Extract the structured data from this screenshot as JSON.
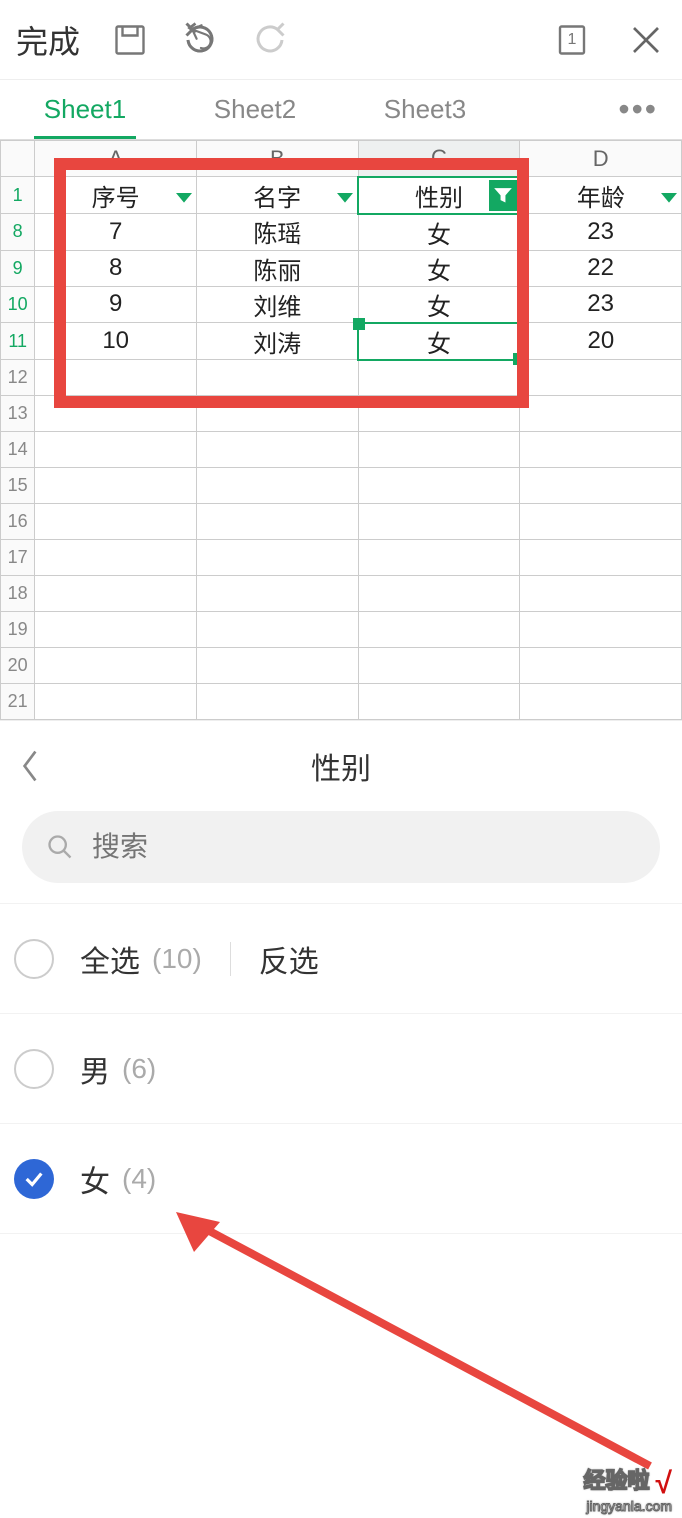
{
  "toolbar": {
    "done_label": "完成",
    "notif_count": "1"
  },
  "sheets": {
    "tab1": "Sheet1",
    "tab2": "Sheet2",
    "tab3": "Sheet3",
    "more": "•••"
  },
  "columns": {
    "A": "A",
    "B": "B",
    "C": "C",
    "D": "D"
  },
  "headers": {
    "A": "序号",
    "B": "名字",
    "C": "性别",
    "D": "年龄"
  },
  "rownums": {
    "h": "1",
    "r1": "8",
    "r2": "9",
    "r3": "10",
    "r4": "11",
    "e12": "12",
    "e13": "13",
    "e14": "14",
    "e15": "15",
    "e16": "16",
    "e17": "17",
    "e18": "18",
    "e19": "19",
    "e20": "20",
    "e21": "21"
  },
  "rows": {
    "r1": {
      "A": "7",
      "B": "陈瑶",
      "C": "女",
      "D": "23"
    },
    "r2": {
      "A": "8",
      "B": "陈丽",
      "C": "女",
      "D": "22"
    },
    "r3": {
      "A": "9",
      "B": "刘维",
      "C": "女",
      "D": "23"
    },
    "r4": {
      "A": "10",
      "B": "刘涛",
      "C": "女",
      "D": "20"
    }
  },
  "panel": {
    "title": "性别",
    "search_placeholder": "搜索",
    "selectall_label": "全选",
    "selectall_count": "(10)",
    "invert_label": "反选",
    "opt_male_label": "男",
    "opt_male_count": "(6)",
    "opt_female_label": "女",
    "opt_female_count": "(4)"
  },
  "watermark": {
    "line1": "经验啦",
    "line2": "jingyanla.com",
    "check": "√"
  }
}
